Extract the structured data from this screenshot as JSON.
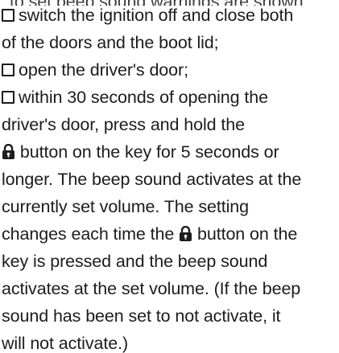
{
  "instructions": {
    "lines": [
      "cut-off top line",
      "switch the ignition off and close both",
      "of the doors and the boot lid;",
      "open the driver's door;",
      "within 30 seconds of opening the",
      "driver's door, press and hold the",
      "button on the key for 5 seconds or",
      "longer. The beep sound activates at the",
      "currently set volume. The setting",
      "changes each time the",
      "button on the",
      "key is pressed and the beep sound",
      "activates at the set volume. (If the beep",
      "sound has been set to not activate, it",
      "will not activate.)"
    ],
    "bullet_icon": "checkbox-bullet-icon",
    "lock_icon": "lock-icon"
  }
}
